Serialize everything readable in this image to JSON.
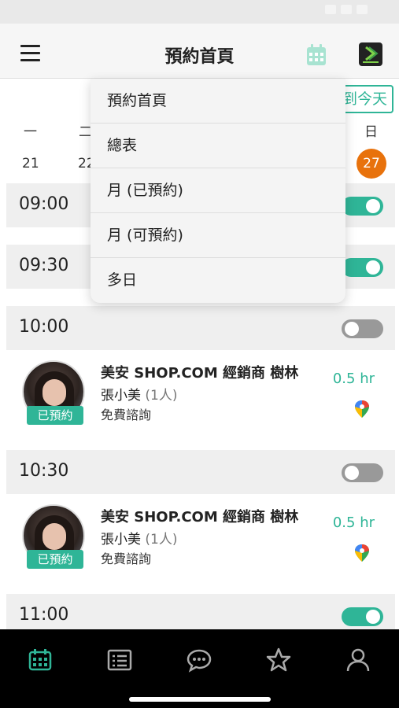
{
  "header": {
    "title": "預約首頁",
    "menu_icon": "hamburger-menu-icon",
    "calendar_icon": "calendar-icon",
    "brand_icon": "ecfunfy-logo-icon"
  },
  "week": {
    "today_button": "到今天",
    "weekday_labels": [
      "一",
      "二",
      "日"
    ],
    "dates": [
      "21",
      "22",
      "27"
    ]
  },
  "dropdown": {
    "items": [
      "預約首頁",
      "總表",
      "月 (已預約)",
      "月 (可預約)",
      "多日"
    ]
  },
  "slots": [
    {
      "time": "09:00",
      "enabled": true
    },
    {
      "time": "09:30",
      "enabled": true
    },
    {
      "time": "10:00",
      "enabled": false
    },
    {
      "time": "10:30",
      "enabled": false
    },
    {
      "time": "11:00",
      "enabled": true
    }
  ],
  "bookings": [
    {
      "badge": "已預約",
      "shop": "美安 SHOP.COM 經銷商 樹林",
      "customer": "張小美",
      "count": "(1人)",
      "service": "免費諮詢",
      "duration": "0.5 hr",
      "map_icon": "google-maps-icon"
    },
    {
      "badge": "已預約",
      "shop": "美安 SHOP.COM 經銷商 樹林",
      "customer": "張小美",
      "count": "(1人)",
      "service": "免費諮詢",
      "duration": "0.5 hr",
      "map_icon": "google-maps-icon"
    }
  ],
  "bottom_nav": [
    "calendar-icon",
    "list-icon",
    "chat-icon",
    "star-icon",
    "profile-icon"
  ],
  "colors": {
    "accent": "#2fb597",
    "today": "#e8720c",
    "nav_bg": "#000000"
  }
}
